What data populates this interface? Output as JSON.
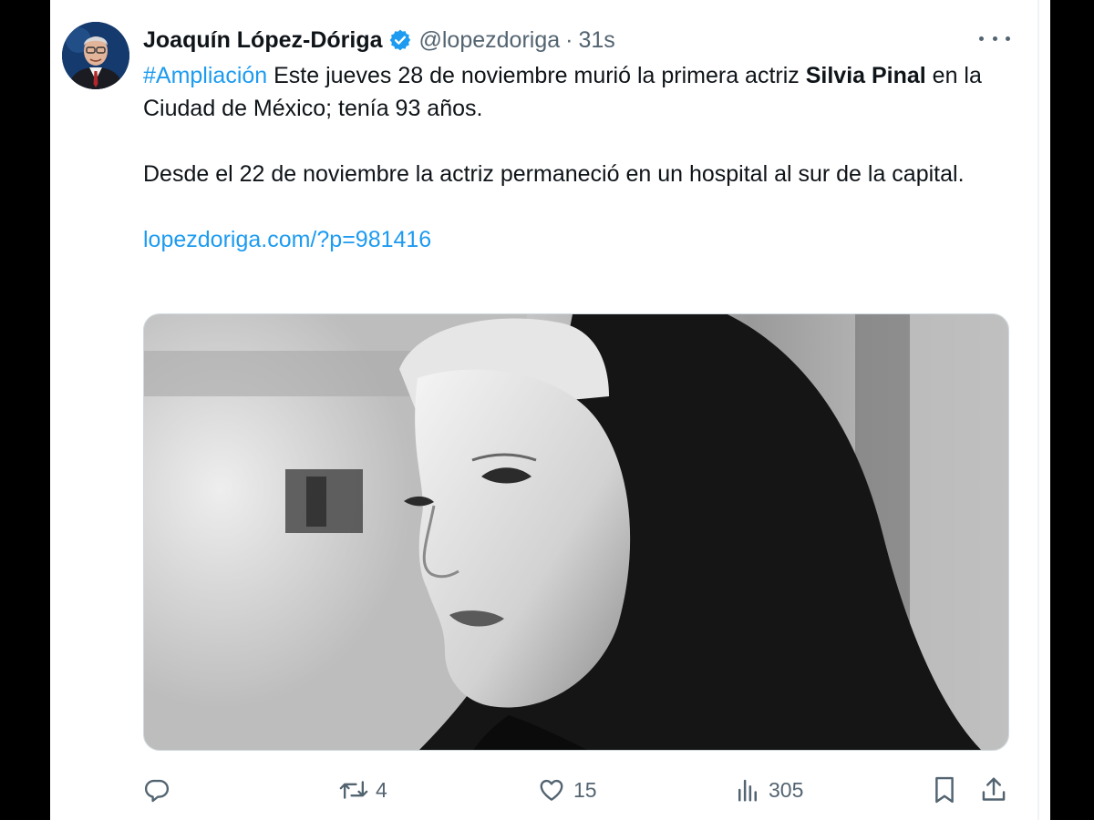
{
  "author": {
    "name": "Joaquín López-Dóriga",
    "handle": "@lopezdoriga",
    "separator": "·",
    "time": "31s"
  },
  "tweet": {
    "hashtag": "#Ampliación",
    "text_part1": " Este jueves 28 de noviembre murió la primera actriz ",
    "bold_name": "Silvia Pinal",
    "text_part2": " en la Ciudad de México; tenía 93 años.",
    "paragraph2": "Desde el 22 de noviembre la actriz permaneció en un hospital al sur de la capital.",
    "link": "lopezdoriga.com/?p=981416"
  },
  "actions": {
    "replies": "",
    "retweets": "4",
    "likes": "15",
    "views": "305"
  },
  "icons": {
    "verified": "verified-badge-icon",
    "more": "more-options-icon",
    "reply": "reply-icon",
    "retweet": "retweet-icon",
    "like": "heart-icon",
    "views": "views-chart-icon",
    "bookmark": "bookmark-icon",
    "share": "share-icon"
  },
  "colors": {
    "accent": "#1d9bf0",
    "text": "#0f1419",
    "muted": "#536471",
    "frame": "#000000"
  }
}
